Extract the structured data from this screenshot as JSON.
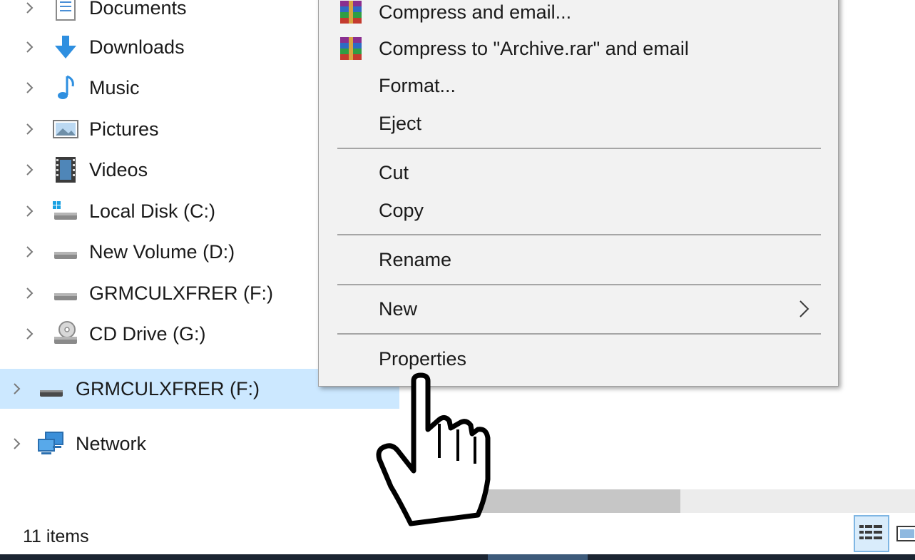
{
  "navigation_pane": {
    "items": [
      {
        "label": "Documents",
        "icon": "documents-icon"
      },
      {
        "label": "Downloads",
        "icon": "downloads-icon"
      },
      {
        "label": "Music",
        "icon": "music-icon"
      },
      {
        "label": "Pictures",
        "icon": "pictures-icon"
      },
      {
        "label": "Videos",
        "icon": "videos-icon"
      },
      {
        "label": "Local Disk (C:)",
        "icon": "local-disk-icon"
      },
      {
        "label": "New Volume (D:)",
        "icon": "drive-icon"
      },
      {
        "label": "GRMCULXFRER (F:)",
        "icon": "drive-icon"
      },
      {
        "label": "CD Drive (G:)",
        "icon": "cd-drive-icon"
      }
    ],
    "selected_item": {
      "label": "GRMCULXFRER (F:)",
      "icon": "removable-drive-icon"
    },
    "network": {
      "label": "Network",
      "icon": "network-icon"
    }
  },
  "context_menu": {
    "items": [
      {
        "label": "Compress and email...",
        "icon": "winrar-icon"
      },
      {
        "label": "Compress to \"Archive.rar\" and email",
        "icon": "winrar-icon"
      },
      {
        "label": "Format..."
      },
      {
        "label": "Eject"
      },
      {
        "label": "Cut"
      },
      {
        "label": "Copy"
      },
      {
        "label": "Rename"
      },
      {
        "label": "New",
        "submenu_icon": "chevron-right-icon"
      },
      {
        "label": "Properties"
      }
    ]
  },
  "status_bar": {
    "item_count": "11 items",
    "views": [
      "details-view-icon",
      "large-icons-view-icon"
    ],
    "active_view": "details-view-icon"
  },
  "cursor": {
    "type": "hand-pointer-icon"
  },
  "colors": {
    "selection": "#cce8ff",
    "menu_background": "#f2f2f2",
    "separator": "#a6a6a6",
    "accent_blue": "#2e8fe0"
  }
}
